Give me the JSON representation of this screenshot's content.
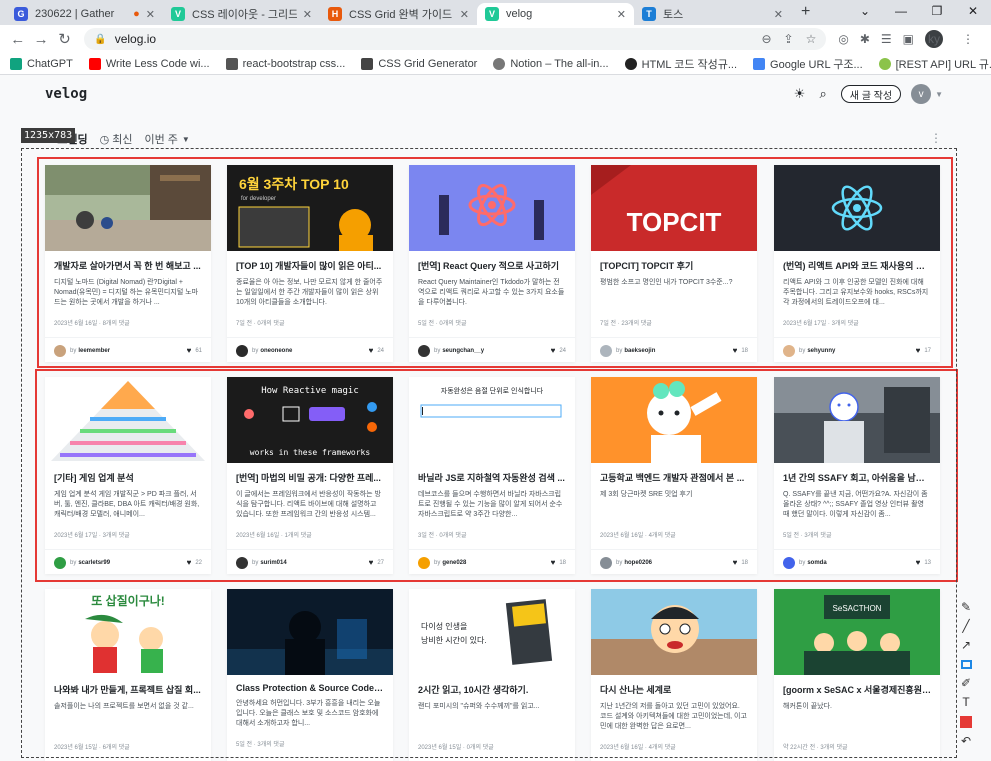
{
  "browser": {
    "tabs": [
      {
        "title": "230622 | Gather",
        "fav_color": "#3b5bdb",
        "fav_glyph": "G",
        "active": false
      },
      {
        "title": "CSS 레이아웃 - 그리드",
        "fav_color": "#20c997",
        "fav_glyph": "V",
        "active": false
      },
      {
        "title": "CSS Grid 완벽 가이드 | H",
        "fav_color": "#e8590c",
        "fav_glyph": "H",
        "active": false
      },
      {
        "title": "velog",
        "fav_color": "#20c997",
        "fav_glyph": "V",
        "active": true
      },
      {
        "title": "토스",
        "fav_color": "#1c7ed6",
        "fav_glyph": "T",
        "active": false
      }
    ],
    "new_tab": "+",
    "url": "velog.io",
    "profile_initials": "ky",
    "bookmarks": [
      {
        "label": "ChatGPT",
        "color": "#10a37f"
      },
      {
        "label": "Write Less Code wi...",
        "color": "#ff0000"
      },
      {
        "label": "react-bootstrap css...",
        "color": "#555555"
      },
      {
        "label": "CSS Grid Generator",
        "color": "#444444"
      },
      {
        "label": "Notion – The all-in...",
        "color": "#777777"
      },
      {
        "label": "HTML 코드 작성규...",
        "color": "#222222"
      },
      {
        "label": "Google URL 구조...",
        "color": "#4285f4"
      },
      {
        "label": "[REST API] URL 규...",
        "color": "#8bc34a"
      }
    ]
  },
  "velog": {
    "logo": "velog",
    "write_button": "새 글 작성",
    "avatar_initial": "v"
  },
  "filters": {
    "trending": "트렌딩",
    "recent": "최신",
    "period": "이번 주"
  },
  "capture_size": "1235x783",
  "posts": [
    {
      "title": "개발자로 살아가면서 꼭 한 번 해보고 ...",
      "desc": "디지털 노마드 (Digital Nomad) 란?Digital + Nomad(유목민) = 디지털 하는 유목민디지털 노마드는 원하는 곳에서 개발을 하거나 ...",
      "meta": "2023년 6월 16일 · 8개의 댓글",
      "user": "leemember",
      "likes": "61",
      "thumb": "street",
      "avatar_color": "#c9a27c"
    },
    {
      "title": "[TOP 10] 개발자들이 많이 읽은 아티...",
      "desc": "종료율은 아 아는 정보, 나만 모르지 않게 한 줄어주는 일일일에서 한 주간 개발자들이 많이 읽은 상위 10개의 아티클들을 소개합니다.",
      "meta": "7일 전 · 0개의 댓글",
      "user": "oneoneone",
      "likes": "24",
      "thumb": "top10",
      "avatar_color": "#2b2b2b"
    },
    {
      "title": "[번역] React Query 적으로 사고하기",
      "desc": "React Query Maintainer인 Tkdodo가 말하는 전역으로 리액트 쿼리로 사고할 수 있는 3가지 요소들을 다루어봅니다.",
      "meta": "5일 전 · 0개의 댓글",
      "user": "seungchan__y",
      "likes": "24",
      "thumb": "rq",
      "avatar_color": "#333333"
    },
    {
      "title": "[TOPCIT] TOPCIT 후기",
      "desc": "평범한 소프고 명인인 내가 TOPCIT 3수준...?",
      "meta": "7일 전 · 23개의 댓글",
      "user": "baekseojin",
      "likes": "18",
      "thumb": "topcit",
      "avatar_color": "#adb5bd"
    },
    {
      "title": "(번역) 리액트 API와 코드 재사용의 진...",
      "desc": "리액트 API와 그 이후 인공한 모델인 진화에 대해 주목합니다. 그리고 유지보수와 hooks, RSCs까지 각 과정에서의 트레이드오프에 대...",
      "meta": "2023년 6월 17일 · 3개의 댓글",
      "user": "sehyunny",
      "likes": "17",
      "thumb": "react",
      "avatar_color": "#e0b48a"
    },
    {
      "title": "[기타] 게임 업계 분석",
      "desc": "게임 업계 분석 게임 개발직군 > PD 파크 플러, 서버, 툴, 엔진, 클라BE, DBA 아트 캐릭터/배경 원화, 캐릭터/배경 모델러, 애니메이...",
      "meta": "2023년 6월 17일 · 3개의 댓글",
      "user": "scarletsr99",
      "likes": "22",
      "thumb": "pyramid",
      "avatar_color": "#2f9e44"
    },
    {
      "title": "[번역] 마법의 비밀 공개: 다양한 프레...",
      "desc": "이 글에서는 프레임워크에서 반응성이 작동하는 방식을 탐구합니다. 리액트 바이브에 대해 설명하고 있습니다. 또한 프레임워크 간의 반응성 시스템...",
      "meta": "2023년 6월 16일 · 1개의 댓글",
      "user": "surim014",
      "likes": "27",
      "thumb": "reactive",
      "avatar_color": "#333333"
    },
    {
      "title": "바닐라 JS로 지하철역 자동완성 검색 ...",
      "desc": "데브코스를 들으며 수행하면서 바닐라 자바스크립트로 진행될 수 있는 기능을 많이 알게 되어서 순수 자바스크립트로 약 3주간 다양한...",
      "meta": "3일 전 · 0개의 댓글",
      "user": "gene028",
      "likes": "18",
      "thumb": "search",
      "avatar_color": "#f59f00"
    },
    {
      "title": "고등학교 백엔드 개발자 관점에서 본 ...",
      "desc": "제 3회 당근마켓 SRE 밋업 후기",
      "meta": "2023년 6월 16일 · 4개의 댓글",
      "user": "hope0206",
      "likes": "18",
      "thumb": "carrot",
      "avatar_color": "#868e96"
    },
    {
      "title": "1년 간의 SSAFY 회고, 아쉬움을 남기...",
      "desc": "Q. SSAFY를 끝낸 지금, 어떤가요?A. 자신감이 좀 올라온 상태? ^^;; SSAFY 졸업 영상 인터뷰 촬영 때 했던 말이다. 이렇게 자신감이 좀...",
      "meta": "5일 전 · 3개의 댓글",
      "user": "somda",
      "likes": "13",
      "thumb": "ssafy",
      "avatar_color": "#4263eb"
    },
    {
      "title": "나와봐 내가 만들게, 프록젝트 삽질 회...",
      "desc": "솔저플이는 나의 프로젝트를 보면서 없을 것 같...",
      "meta": "2023년 6월 15일 · 6개의 댓글",
      "user": "",
      "likes": "",
      "thumb": "shovel",
      "avatar_color": "#ffffff"
    },
    {
      "title": "Class Protection & Source Code En...",
      "desc": "안녕하세요 허먼입니다. 3부가 흥흥을 내리는 오늘 입니다. 오늘은 클래스 보호 및 소스코드 암호화에 대해서 소개하고자 합니...",
      "meta": "5일 전 · 3개의 댓글",
      "user": "",
      "likes": "",
      "thumb": "hacker",
      "avatar_color": "#ffffff"
    },
    {
      "title": "2시간 읽고, 10시간 생각하기.",
      "desc": "랜디 포미시의 \"슈퍼와 수수께끼\"를 읽고...",
      "meta": "2023년 6월 15일 · 0개의 댓글",
      "user": "",
      "likes": "",
      "thumb": "book",
      "avatar_color": "#ffffff"
    },
    {
      "title": "다시 산나는 세계로",
      "desc": "지난 1년간의 저를 돌아고 있던 고민이 있었어요. 코드 설계와 아키텍쳐들에 대한 고민이었는데, 이고민에 대한 완벽한 답은 요로면...",
      "meta": "2023년 6월 16일 · 4개의 댓글",
      "user": "",
      "likes": "",
      "thumb": "shin",
      "avatar_color": "#ffffff"
    },
    {
      "title": "[goorm x SeSAC x 서울경제진흥원] ...",
      "desc": "해커톤이 끝났다.",
      "meta": "약 22시간 전 · 3개의 댓글",
      "user": "",
      "likes": "",
      "thumb": "hackathon",
      "avatar_color": "#ffffff"
    }
  ],
  "thumb_text": {
    "top10_title": "6월 3주차 TOP 10",
    "top10_sub": "for developer",
    "topcit": "TOPCIT",
    "reactive_top": "How Reactive magic",
    "reactive_bottom": "works in these frameworks",
    "search_heading": "자동완성은 음절 단위로 인식합니다",
    "shovel_text": "또 삽질이구나!",
    "book_line1": "다이성 인생을",
    "book_line2": "낭비한 시간이 있다.",
    "hackathon_sign": "SeSACTHON"
  },
  "colors": {
    "accent": "#12b886",
    "red_frame": "#e53935"
  }
}
